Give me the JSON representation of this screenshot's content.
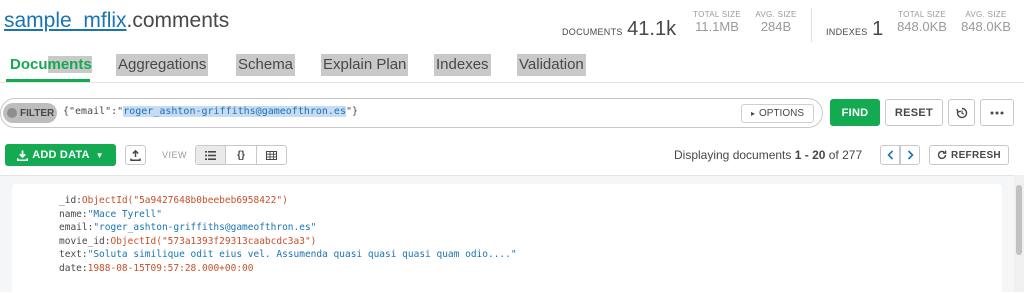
{
  "header": {
    "db_name": "sample_mflix",
    "collection_name": ".comments",
    "documents_label": "DOCUMENTS",
    "documents_value": "41.1k",
    "total_size_label": "TOTAL SIZE",
    "total_size_value": "11.1MB",
    "avg_size_label": "AVG. SIZE",
    "avg_size_value": "284B",
    "indexes_label": "INDEXES",
    "indexes_value": "1",
    "idx_total_size_label": "TOTAL SIZE",
    "idx_total_size_value": "848.0KB",
    "idx_avg_size_label": "AVG. SIZE",
    "idx_avg_size_value": "848.0KB"
  },
  "tabs": {
    "documents_head": "Docu",
    "documents_tail": "ments",
    "aggregations": "Aggregations",
    "schema": "Schema",
    "explain_plan": "Explain Plan",
    "indexes": "Indexes",
    "validation": "Validation"
  },
  "filter": {
    "pill_label": "FILTER",
    "query_prefix": "{\"email\":\"",
    "query_value": "roger_ashton-griffiths@gameofthron.es",
    "query_suffix": "\"}",
    "options_label": "OPTIONS",
    "find_label": "FIND",
    "reset_label": "RESET"
  },
  "toolbar": {
    "add_data_label": "ADD DATA",
    "view_label": "VIEW",
    "displaying_prefix": "Displaying documents ",
    "range": "1 - 20",
    "of_text": " of ",
    "total": "277",
    "refresh_label": "REFRESH"
  },
  "document": {
    "id_key": "_id:",
    "id_value": "ObjectId(\"5a9427648b0beebeb6958422\")",
    "name_key": "name:",
    "name_value": "\"Mace Tyrell\"",
    "email_key": "email:",
    "email_value": "\"roger_ashton-griffiths@gameofthron.es\"",
    "movie_id_key": "movie_id:",
    "movie_id_value": "ObjectId(\"573a1393f29313caabcdc3a3\")",
    "text_key": "text:",
    "text_value": "\"Soluta similique odit eius vel. Assumenda quasi quasi quasi quam odio....\"",
    "date_key": "date:",
    "date_value": "1988-08-15T09:57:28.000+00:00"
  },
  "colors": {
    "accent_green": "#13aa52",
    "link_blue": "#1a74b3",
    "oid_orange": "#c6502b"
  }
}
